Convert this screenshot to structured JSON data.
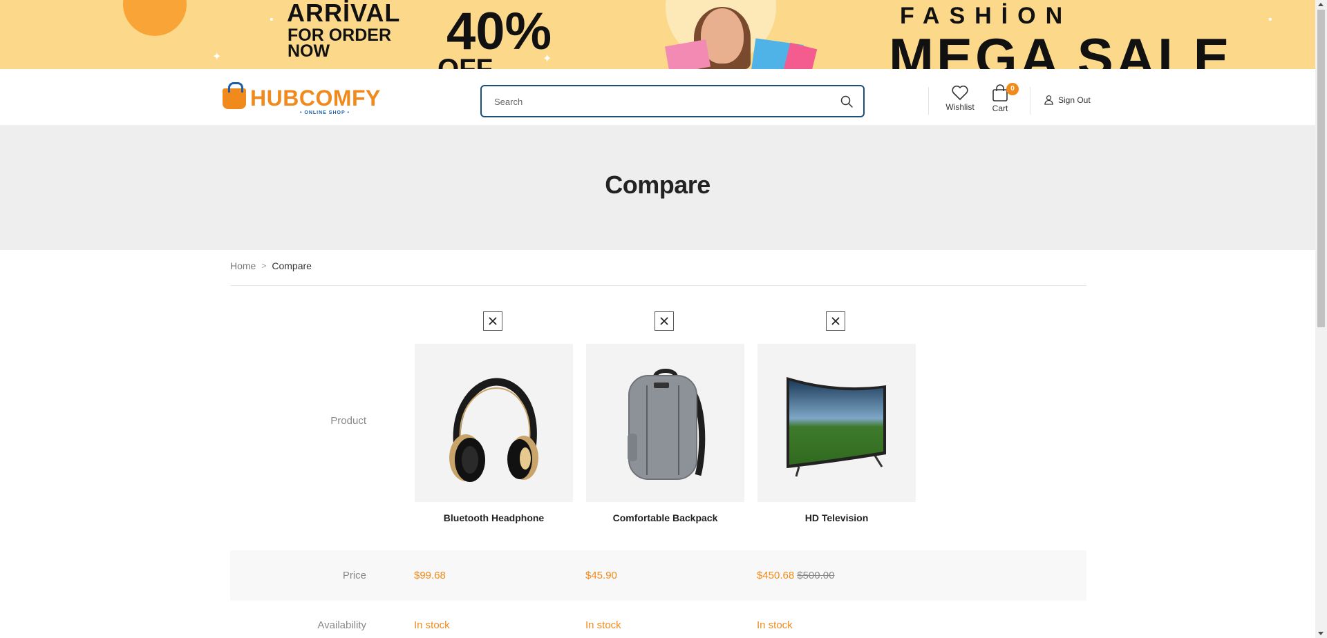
{
  "banner": {
    "arrival": "ARRİVAL",
    "for_order": "FOR ORDER\nNOW",
    "percent": "40%",
    "off": "OFF",
    "fashion": "FASHİON",
    "mega_sale": "MEGA SALE"
  },
  "header": {
    "logo_text": "HUBCOMFY",
    "logo_tagline": "• ONLINE SHOP •",
    "search_placeholder": "Search",
    "wishlist_label": "Wishlist",
    "cart_label": "Cart",
    "cart_count": "0",
    "signout_label": "Sign Out"
  },
  "page": {
    "title": "Compare"
  },
  "breadcrumb": {
    "home": "Home",
    "separator": ">",
    "current": "Compare"
  },
  "compare": {
    "labels": {
      "product": "Product",
      "price": "Price",
      "availability": "Availability"
    },
    "products": [
      {
        "name": "Bluetooth Headphone",
        "price": "$99.68",
        "old_price": "",
        "availability": "In stock",
        "image_icon": "headphone-image"
      },
      {
        "name": "Comfortable Backpack",
        "price": "$45.90",
        "old_price": "",
        "availability": "In stock",
        "image_icon": "backpack-image"
      },
      {
        "name": "HD Television",
        "price": "$450.68",
        "old_price": "$500.00",
        "availability": "In stock",
        "image_icon": "television-image"
      }
    ]
  },
  "colors": {
    "accent": "#f08a1c",
    "search_border": "#1c4f7a",
    "banner_bg": "#fcd98a",
    "title_band_bg": "#eeeeee"
  }
}
